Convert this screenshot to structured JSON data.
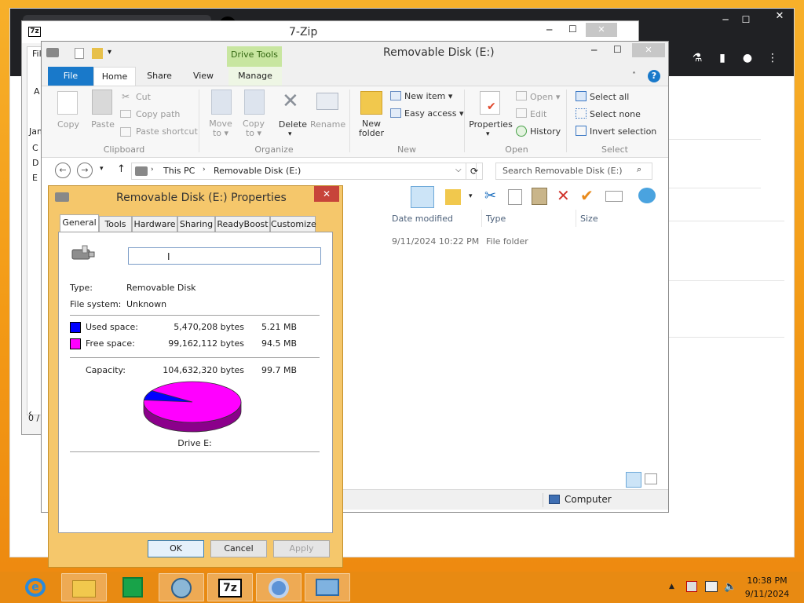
{
  "chrome": {
    "tab_label": ""
  },
  "zip": {
    "title": "7-Zip",
    "icon_label": "7z",
    "left_items": [
      "Fil",
      "A",
      "Jam",
      "C",
      "D",
      "E"
    ],
    "status": "0 /"
  },
  "explorer": {
    "title": "Removable Disk (E:)",
    "contextual_tab": "Drive Tools",
    "tabs": [
      "File",
      "Home",
      "Share",
      "View",
      "Manage"
    ],
    "clipboard": {
      "copy": "Copy",
      "paste": "Paste",
      "cut": "Cut",
      "copy_path": "Copy path",
      "paste_shortcut": "Paste shortcut",
      "group": "Clipboard"
    },
    "organize": {
      "move_to": "Move to",
      "copy_to": "Copy to",
      "delete": "Delete",
      "rename": "Rename",
      "group": "Organize"
    },
    "new": {
      "new_folder_1": "New",
      "new_folder_2": "folder",
      "new_item": "New item",
      "easy_access": "Easy access",
      "group": "New"
    },
    "open": {
      "properties": "Properties",
      "open": "Open",
      "edit": "Edit",
      "history": "History",
      "group": "Open"
    },
    "select": {
      "select_all": "Select all",
      "select_none": "Select none",
      "invert": "Invert selection",
      "group": "Select"
    },
    "breadcrumb": [
      "This PC",
      "Removable Disk (E:)"
    ],
    "search_placeholder": "Search Removable Disk (E:)",
    "columns": [
      "Date modified",
      "Type",
      "Size"
    ],
    "rows": [
      {
        "date": "9/11/2024 10:22 PM",
        "type": "File folder",
        "size": ""
      }
    ],
    "status_location": "Computer"
  },
  "properties": {
    "title": "Removable Disk (E:) Properties",
    "tabs": [
      "General",
      "Tools",
      "Hardware",
      "Sharing",
      "ReadyBoost",
      "Customize"
    ],
    "label_value": "",
    "type_label": "Type:",
    "type_value": "Removable Disk",
    "fs_label": "File system:",
    "fs_value": "Unknown",
    "used_label": "Used space:",
    "used_bytes": "5,470,208 bytes",
    "used_size": "5.21 MB",
    "free_label": "Free space:",
    "free_bytes": "99,162,112 bytes",
    "free_size": "94.5 MB",
    "capacity_label": "Capacity:",
    "capacity_bytes": "104,632,320 bytes",
    "capacity_size": "99.7 MB",
    "drive_label": "Drive E:",
    "used_fraction": 0.0523,
    "used_color": "#0000ff",
    "free_color": "#ff00ff",
    "ok": "OK",
    "cancel": "Cancel",
    "apply": "Apply"
  },
  "taskbar": {
    "items": [
      "internet-explorer-icon",
      "file-explorer-icon",
      "store-icon",
      "mosaic-icon",
      "7zip-icon",
      "chrome-icon",
      "remote-desktop-icon"
    ],
    "zip_label": "7z",
    "time": "10:38 PM",
    "date": "9/11/2024"
  }
}
